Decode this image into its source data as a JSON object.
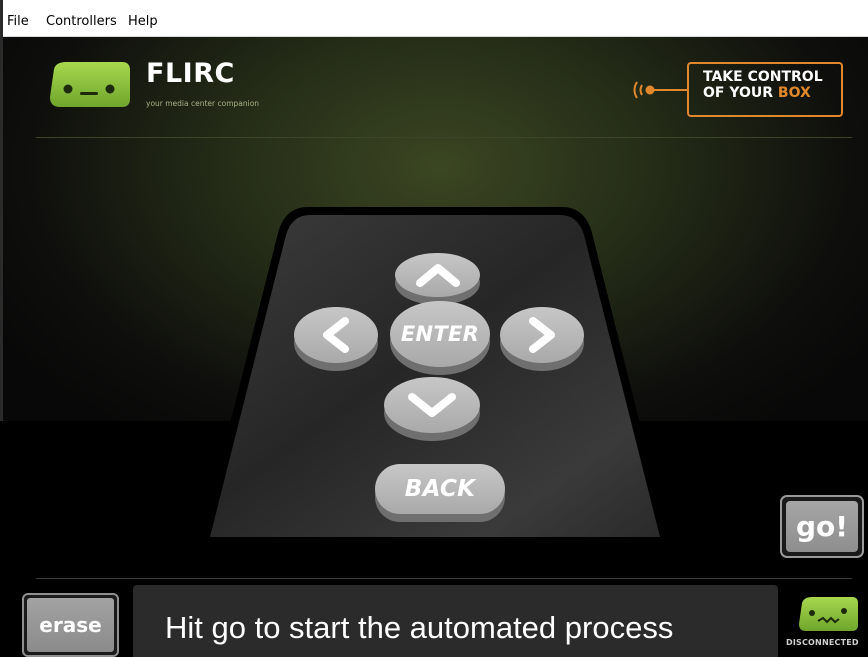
{
  "menu": {
    "items": [
      "File",
      "Controllers",
      "Help"
    ]
  },
  "header": {
    "brand": "FLIRC",
    "tagline": "your media center companion",
    "promo_line1": "TAKE CONTROL",
    "promo_line2_a": "OF YOUR",
    "promo_line2_b": "BOX"
  },
  "remote": {
    "up_icon": "chevron-up-icon",
    "left_icon": "chevron-left-icon",
    "right_icon": "chevron-right-icon",
    "down_icon": "chevron-down-icon",
    "enter_label": "ENTER",
    "back_label": "BACK"
  },
  "controls": {
    "go_label": "go!",
    "erase_label": "erase",
    "status_message": "Hit go to start the automated process",
    "connection_status": "DISCONNECTED"
  },
  "colors": {
    "brand_green": "#8cc63f",
    "accent_orange": "#e1882d",
    "button_gray": "#b5b5b5"
  }
}
